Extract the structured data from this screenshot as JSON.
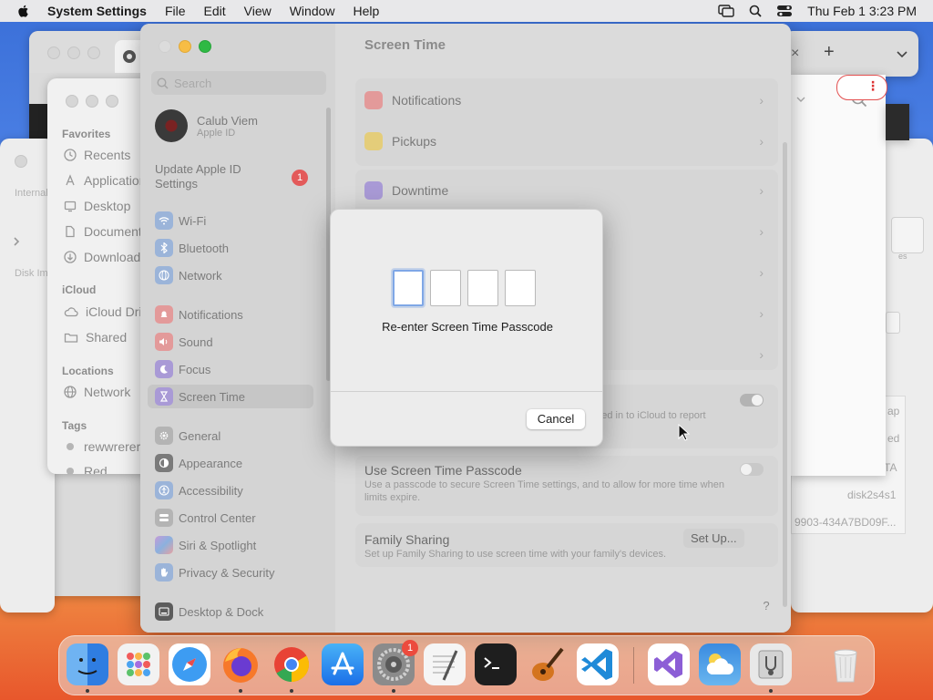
{
  "menubar": {
    "app_name": "System Settings",
    "items": [
      "File",
      "Edit",
      "View",
      "Window",
      "Help"
    ],
    "clock": "Thu Feb 1  3:23 PM"
  },
  "finder": {
    "favorites_header": "Favorites",
    "favorites": [
      "Recents",
      "Applications",
      "Desktop",
      "Documents",
      "Downloads"
    ],
    "icloud_header": "iCloud",
    "icloud": [
      "iCloud Drive",
      "Shared"
    ],
    "locations_header": "Locations",
    "locations": [
      "Network"
    ],
    "tags_header": "Tags",
    "tags": [
      "rewwrerererer",
      "Red"
    ]
  },
  "disk_left": {
    "internal": "Internal",
    "disk_images": "Disk Im"
  },
  "disk_right": {
    "rows": [
      "ap",
      "ed",
      "TA",
      "disk2s4s1",
      "9903-434A7BD09F..."
    ],
    "small": "es"
  },
  "settings": {
    "title": "Screen Time",
    "search_placeholder": "Search",
    "profile": {
      "name": "Calub Viem",
      "sub": "Apple ID"
    },
    "update": {
      "label": "Update Apple ID Settings",
      "badge": "1"
    },
    "sidebar": {
      "wifi": "Wi-Fi",
      "bluetooth": "Bluetooth",
      "network": "Network",
      "notifications": "Notifications",
      "sound": "Sound",
      "focus": "Focus",
      "screen_time": "Screen Time",
      "general": "General",
      "appearance": "Appearance",
      "accessibility": "Accessibility",
      "control_center": "Control Center",
      "siri": "Siri & Spotlight",
      "privacy": "Privacy & Security",
      "desktop_dock": "Desktop & Dock"
    },
    "content": {
      "notifications": "Notifications",
      "pickups": "Pickups",
      "downtime": "Downtime",
      "share_desc_fragment": "gned in to iCloud to report",
      "passcode_title": "Use Screen Time Passcode",
      "passcode_desc": "Use a passcode to secure Screen Time settings, and to allow for more time when limits expire.",
      "family_title": "Family Sharing",
      "family_desc": "Set up Family Sharing to use screen time with your family's devices.",
      "setup_button": "Set Up...",
      "help": "?"
    }
  },
  "dialog": {
    "label": "Re-enter Screen Time Passcode",
    "cancel": "Cancel",
    "code_length": 4
  },
  "dock": {
    "apps": [
      "Finder",
      "Launchpad",
      "Safari",
      "Firefox",
      "Chrome",
      "App Store",
      "System Settings",
      "TextEdit",
      "Terminal",
      "GarageBand",
      "VS Code",
      "Visual Studio",
      "Weather",
      "Disk Utility",
      "Trash"
    ],
    "settings_badge": "1"
  }
}
